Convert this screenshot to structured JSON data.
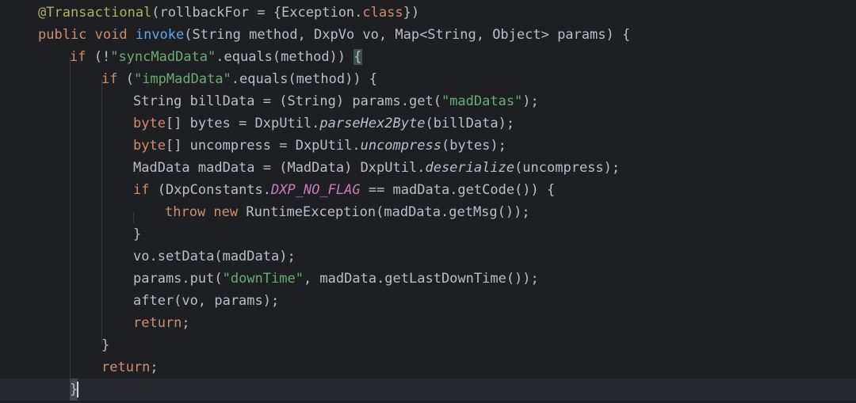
{
  "editor": {
    "lines": [
      {
        "tokens": [
          {
            "t": "@Transactional",
            "c": "ann"
          },
          {
            "t": "(rollbackFor = {Exception.",
            "c": "plain"
          },
          {
            "t": "class",
            "c": "kw"
          },
          {
            "t": "})",
            "c": "plain"
          }
        ]
      },
      {
        "tokens": [
          {
            "t": "public ",
            "c": "kw"
          },
          {
            "t": "void ",
            "c": "kw"
          },
          {
            "t": "invoke",
            "c": "fn"
          },
          {
            "t": "(String method, DxpVo vo, Map<String, Object> params) {",
            "c": "plain"
          }
        ]
      },
      {
        "tokens": [
          {
            "t": "if ",
            "c": "kw"
          },
          {
            "t": "(!",
            "c": "plain"
          },
          {
            "t": "\"syncMadData\"",
            "c": "str"
          },
          {
            "t": ".equals(method)) ",
            "c": "plain"
          },
          {
            "t": "{",
            "c": "brace"
          }
        ]
      },
      {
        "tokens": [
          {
            "t": "if ",
            "c": "kw"
          },
          {
            "t": "(",
            "c": "plain"
          },
          {
            "t": "\"impMadData\"",
            "c": "str"
          },
          {
            "t": ".equals(method)) {",
            "c": "plain"
          }
        ]
      },
      {
        "tokens": [
          {
            "t": "String billData = (String) params.get(",
            "c": "plain"
          },
          {
            "t": "\"madDatas\"",
            "c": "str"
          },
          {
            "t": ");",
            "c": "plain"
          }
        ]
      },
      {
        "tokens": [
          {
            "t": "byte",
            "c": "kw"
          },
          {
            "t": "[] bytes = DxpUtil.",
            "c": "plain"
          },
          {
            "t": "parseHex2Byte",
            "c": "ital"
          },
          {
            "t": "(billData);",
            "c": "plain"
          }
        ]
      },
      {
        "tokens": [
          {
            "t": "byte",
            "c": "kw"
          },
          {
            "t": "[] uncompress = DxpUtil.",
            "c": "plain"
          },
          {
            "t": "uncompress",
            "c": "ital"
          },
          {
            "t": "(bytes);",
            "c": "plain"
          }
        ]
      },
      {
        "tokens": [
          {
            "t": "MadData madData = (MadData) DxpUtil.",
            "c": "plain"
          },
          {
            "t": "deserialize",
            "c": "ital"
          },
          {
            "t": "(uncompress);",
            "c": "plain"
          }
        ]
      },
      {
        "tokens": [
          {
            "t": "if ",
            "c": "kw"
          },
          {
            "t": "(DxpConstants.",
            "c": "plain"
          },
          {
            "t": "DXP_NO_FLAG",
            "c": "const"
          },
          {
            "t": " == madData.getCode()) {",
            "c": "plain"
          }
        ]
      },
      {
        "tokens": [
          {
            "t": "throw ",
            "c": "kw"
          },
          {
            "t": "new ",
            "c": "kw"
          },
          {
            "t": "RuntimeException(madData.getMsg());",
            "c": "plain"
          }
        ]
      },
      {
        "tokens": [
          {
            "t": "}",
            "c": "plain"
          }
        ]
      },
      {
        "tokens": [
          {
            "t": "vo.setData(madData);",
            "c": "plain"
          }
        ]
      },
      {
        "tokens": [
          {
            "t": "params.put(",
            "c": "plain"
          },
          {
            "t": "\"downTime\"",
            "c": "str"
          },
          {
            "t": ", madData.getLastDownTime());",
            "c": "plain"
          }
        ]
      },
      {
        "tokens": [
          {
            "t": "after(vo, params);",
            "c": "plain"
          }
        ]
      },
      {
        "tokens": [
          {
            "t": "return",
            "c": "kw"
          },
          {
            "t": ";",
            "c": "plain"
          }
        ]
      },
      {
        "tokens": [
          {
            "t": "}",
            "c": "plain"
          }
        ]
      },
      {
        "tokens": [
          {
            "t": "return",
            "c": "kw"
          },
          {
            "t": ";",
            "c": "plain"
          }
        ]
      },
      {
        "tokens": [
          {
            "t": "}",
            "c": "caret"
          }
        ]
      }
    ],
    "current_line": 17,
    "colors": {
      "background": "#1e1f22",
      "keyword": "#cf8e6d",
      "annotation": "#b3ae60",
      "string": "#6aab73",
      "method_declaration": "#56a8f5",
      "constant": "#c77dbb",
      "text": "#bcbec4"
    }
  }
}
